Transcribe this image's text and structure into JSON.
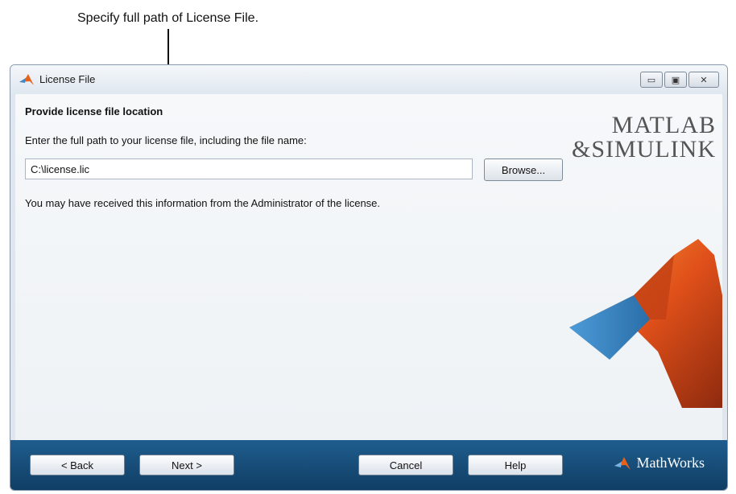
{
  "annotation": {
    "text": "Specify full path of License File."
  },
  "window": {
    "title": "License File",
    "controls": {
      "minimize": "▭",
      "maximize": "▣",
      "close": "✕"
    }
  },
  "content": {
    "heading": "Provide license file location",
    "instruction": "Enter the full path to your license file, including the file name:",
    "path_value": "C:\\license.lic",
    "browse_label": "Browse...",
    "info": "You may have received this information from the Administrator of the license."
  },
  "branding": {
    "matlab": "MATLAB",
    "simulink": "&SIMULINK",
    "mathworks": "MathWorks"
  },
  "footer": {
    "back_label": "< Back",
    "next_label": "Next >",
    "cancel_label": "Cancel",
    "help_label": "Help"
  },
  "colors": {
    "footer_bg": "#1a5282",
    "window_bg": "#dfe6ee",
    "membrane_orange": "#e8611a",
    "membrane_blue": "#3e8ac9"
  },
  "icons": {
    "title": "matlab-membrane-icon",
    "mathworks": "mathworks-logo-icon"
  }
}
